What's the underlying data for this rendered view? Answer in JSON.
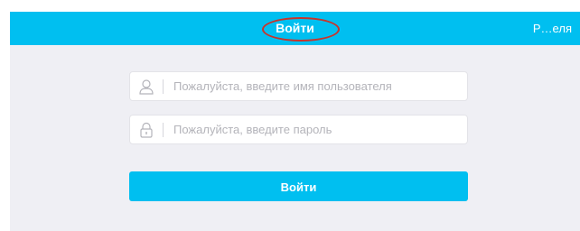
{
  "navbar": {
    "title": "Войти",
    "right_label": "Р…еля",
    "color": "#00bff0"
  },
  "form": {
    "username": {
      "placeholder": "Пожалуйста, введите имя пользователя",
      "icon": "user-icon"
    },
    "password": {
      "placeholder": "Пожалуйста, введите пароль",
      "icon": "lock-icon"
    },
    "submit_label": "Войти"
  },
  "colors": {
    "background": "#efeff4",
    "annotation": "#c8342b"
  }
}
